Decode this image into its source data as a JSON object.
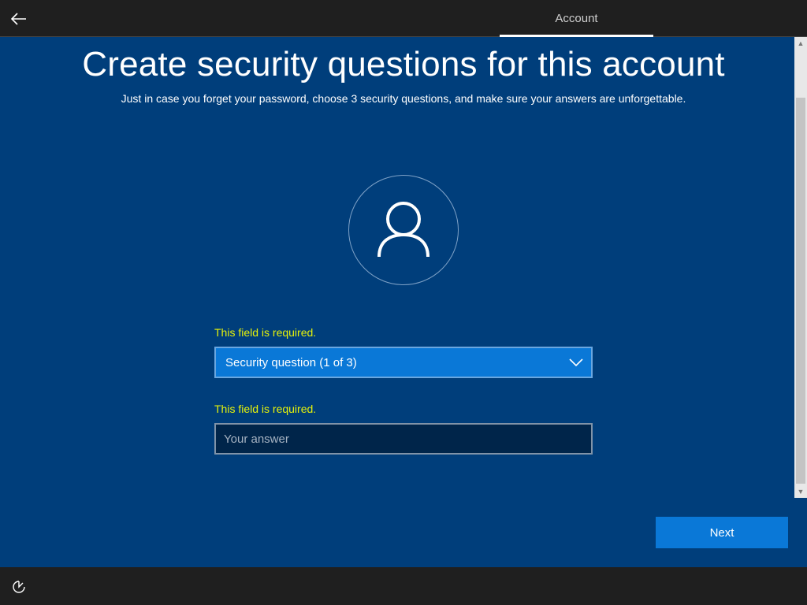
{
  "topbar": {
    "tab_label": "Account",
    "back_icon": "back-arrow-icon"
  },
  "main": {
    "title": "Create security questions for this account",
    "subtitle": "Just in case you forget your password, choose 3 security questions, and make sure your answers are unforgettable.",
    "avatar_icon": "user-icon"
  },
  "form": {
    "question_error": "This field is required.",
    "question_selected": "Security question (1 of 3)",
    "answer_error": "This field is required.",
    "answer_placeholder": "Your answer",
    "answer_value": ""
  },
  "footer": {
    "next_label": "Next",
    "ease_icon": "ease-of-access-icon"
  },
  "colors": {
    "background": "#003e7b",
    "accent": "#0a78d7",
    "error": "#e6f20a",
    "bar": "#1f1f1f"
  }
}
